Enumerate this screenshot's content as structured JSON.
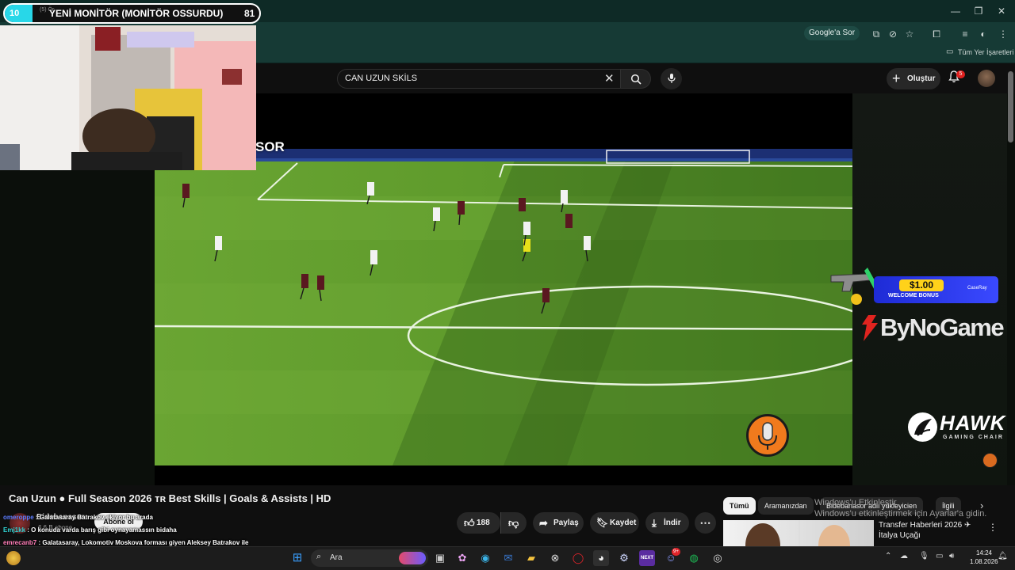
{
  "browser": {
    "window_controls": {
      "minimize": "—",
      "maximize": "❐",
      "close": "✕"
    },
    "google_sor": "Google'a Sor",
    "bookmarks_all": "Tüm Yer İşaretleri"
  },
  "youtube": {
    "search": {
      "value": "CAN UZUN SKİLS",
      "placeholder": "Ara"
    },
    "create_label": "Oluştur",
    "notifications_count": "5"
  },
  "poll": {
    "left_value": "10",
    "title": "YENİ MONİTÖR (MONİTÖR OSSURDU)",
    "right_value": "81",
    "left_fraction": 0.11,
    "ghost_text": "(5) Ör"
  },
  "video_overlay_text": "SOR",
  "ads": {
    "amount": "$1.00",
    "bonus": "WELCOME BONUS",
    "brand_small": "CaseRay",
    "bynogame": "ByNoGame",
    "hawk": "HAWK",
    "hawk_sub": "GAMING CHAIR"
  },
  "video": {
    "title": "Can Uzun ● Full Season 2026 ᴛʀ Best Skills | Goals & Assists | HD",
    "channel": "Bidebanasor",
    "subscribers": "6,6 B abone",
    "subscribe_label": "Abone ol",
    "likes": "188",
    "share_label": "Paylaş",
    "save_label": "Kaydet",
    "download_label": "İndir"
  },
  "chips": [
    "Tümü",
    "Aramanızdan",
    "Bidebanasor adlı yükleyicien",
    "İlgili"
  ],
  "windows_activation": {
    "line1": "Windows'u Etkinleştir",
    "line2": "Windows'u etkinleştirmek için Ayarlar'a gidin."
  },
  "recommendation": {
    "title": "Transfer Haberleri 2026 ✈ İtalya Uçağı"
  },
  "chat": [
    {
      "user": "omeroppe",
      "text": "Galatasaray Batrakov ekiyor bu arada",
      "color": "#5b7bff"
    },
    {
      "user": "Emj1kk",
      "text": "O konuda varda barış gibi oynayamassın bidaha",
      "color": "#2fd2d2"
    },
    {
      "user": "emrecanb7",
      "text": "Galatasaray, Lokomotiv Moskova forması giyen Aleksey Batrakov ile sözleşme şartlarında anlaşmaya vardı! Oyuncunun kulübüne 'resmi ilgi mektubu' yolladı. Kulüpler arası resmi görüşmeler başladı.",
      "color": "#ff7bb6"
    }
  ],
  "taskbar": {
    "search_placeholder": "Ara",
    "time": "14:24",
    "date": "1.08.2026",
    "discord_badge": "9+"
  }
}
